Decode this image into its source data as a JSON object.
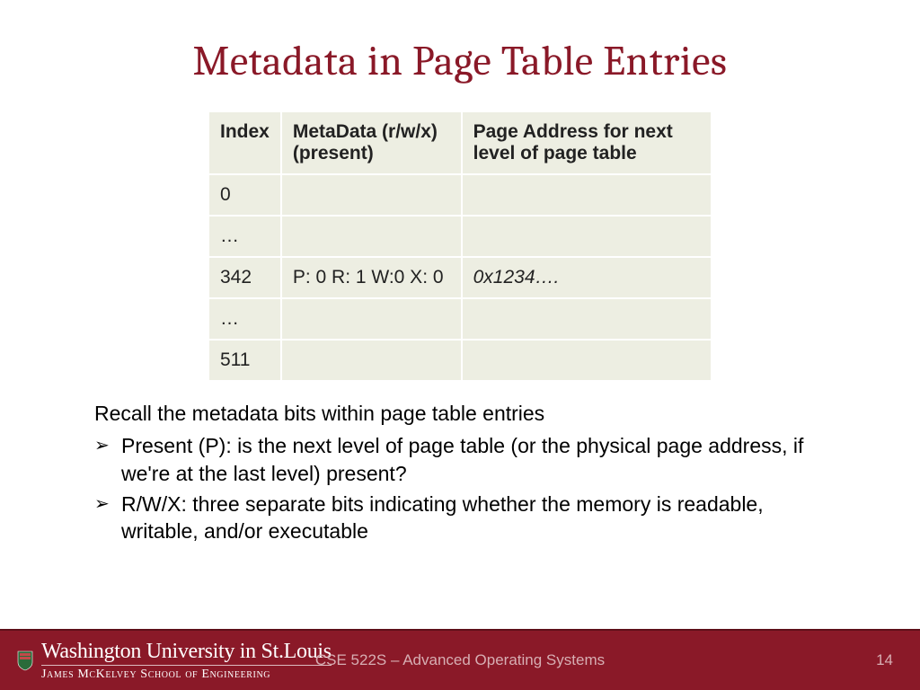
{
  "title": "Metadata in Page Table Entries",
  "table": {
    "headers": [
      "Index",
      "MetaData (r/w/x) (present)",
      "Page Address for next level of page table"
    ],
    "rows": [
      {
        "index": "0",
        "meta": "",
        "addr": ""
      },
      {
        "index": "…",
        "meta": "",
        "addr": ""
      },
      {
        "index": "342",
        "meta": "P: 0 R: 1 W:0 X: 0",
        "addr": "0x1234…."
      },
      {
        "index": "…",
        "meta": "",
        "addr": ""
      },
      {
        "index": "511",
        "meta": "",
        "addr": ""
      }
    ]
  },
  "intro": "Recall the metadata bits within page table entries",
  "bullets": [
    "Present (P): is the next level of page table (or the physical page address, if we're at the last level) present?",
    "R/W/X: three separate bits indicating whether the memory is readable, writable, and/or executable"
  ],
  "footer": {
    "uni_top": "Washington University in St.Louis",
    "uni_bottom": "James McKelvey School of Engineering",
    "course": "CSE 522S – Advanced Operating Systems",
    "page": "14"
  }
}
